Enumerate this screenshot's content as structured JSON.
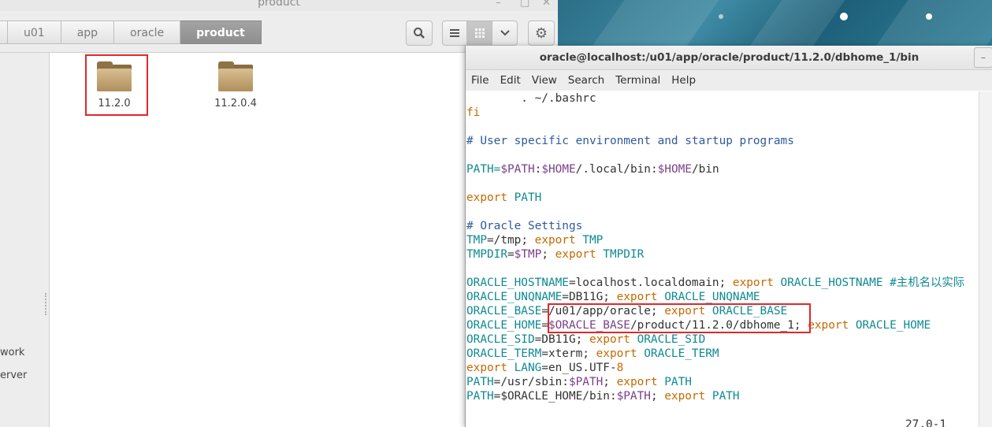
{
  "file_manager": {
    "window_title": "product",
    "breadcrumbs": [
      "u01",
      "app",
      "oracle",
      "product"
    ],
    "active_crumb": "product",
    "toolbar": {
      "search_icon": "search-icon",
      "list_view_icon": "list-view-icon",
      "grid_view_icon": "grid-view-icon",
      "menu_icon": "chevron-down-icon",
      "settings_icon": "gear-icon"
    },
    "sidebar_items": [
      "work",
      "erver"
    ],
    "folders": [
      {
        "name": "11.2.0",
        "highlighted": true
      },
      {
        "name": "11.2.0.4",
        "highlighted": false
      }
    ]
  },
  "terminal": {
    "title": "oracle@localhost:/u01/app/oracle/product/11.2.0/dbhome_1/bin",
    "menu": [
      "File",
      "Edit",
      "View",
      "Search",
      "Terminal",
      "Help"
    ],
    "lines": {
      "l1": "        . ~/.bashrc",
      "l2": "fi",
      "l3": "# User specific environment and startup programs",
      "l4a": "PATH=",
      "l4b": "$PATH",
      "l4c": ":",
      "l4d": "$HOME",
      "l4e": "/.local/bin:",
      "l4f": "$HOME",
      "l4g": "/bin",
      "l5a": "export",
      "l5b": " PATH",
      "l6": "# Oracle Settings",
      "l7a": "TMP",
      "l7b": "=/tmp; ",
      "l7c": "export",
      "l7d": " TMP",
      "l8a": "TMPDIR",
      "l8b": "=",
      "l8c": "$TMP",
      "l8d": "; ",
      "l8e": "export",
      "l8f": " TMPDIR",
      "l9a": "ORACLE_HOSTNAME",
      "l9b": "=localhost.localdomain; ",
      "l9c": "export",
      "l9d": " ORACLE_HOSTNAME #主机名以实际",
      "l10a": "ORACLE_UNQNAME",
      "l10b": "=DB11G; ",
      "l10c": "export",
      "l10d": " ORACLE_UNQNAME",
      "l11a": "ORACLE_BASE",
      "l11b": "=/u01/app/oracle; ",
      "l11c": "export",
      "l11d": " ORACLE_BASE",
      "l12a": "ORACLE_HOME",
      "l12b": "=",
      "l12c": "$ORACLE_BASE",
      "l12d": "/product/11.2.0/dbhome_1; ",
      "l12e": "export",
      "l12f": " ORACLE_HOME",
      "l13a": "ORACLE_SID",
      "l13b": "=DB11G; ",
      "l13c": "export",
      "l13d": " ORACLE_SID",
      "l14a": "ORACLE_TERM",
      "l14b": "=xterm; ",
      "l14c": "export",
      "l14d": " ORACLE_TERM",
      "l15a": "export",
      "l15b": " LANG",
      "l15c": "=en_US.UTF-",
      "l15d": "8",
      "l16a": "PATH",
      "l16b": "=/usr/sbin:",
      "l16c": "$PATH",
      "l16d": "; ",
      "l16e": "export",
      "l16f": " PATH",
      "l17a": "PATH",
      "l17b": "=$ORACLE_HOME/bin:",
      "l17c": "$PATH",
      "l17d": "; ",
      "l17e": "export",
      "l17f": " PATH",
      "status": "27,0-1"
    }
  },
  "colors": {
    "highlight": "#e0282a",
    "comment": "#2f5a9c",
    "keyword": "#c46a00",
    "variable": "#0e8a92",
    "dollar_var": "#7a3f8a"
  }
}
